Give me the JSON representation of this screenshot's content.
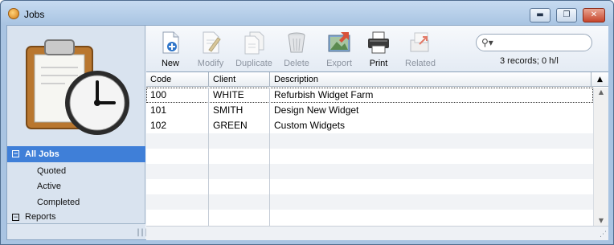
{
  "window": {
    "title": "Jobs",
    "buttons": {
      "minimize": "▬",
      "maximize": "❐",
      "close": "✕"
    }
  },
  "sidebar": {
    "items": [
      {
        "label": "All Jobs",
        "toggle": "⊟",
        "selected": true
      },
      {
        "label": "Quoted"
      },
      {
        "label": "Active"
      },
      {
        "label": "Completed"
      },
      {
        "label": "Reports",
        "toggle": "⊟"
      }
    ]
  },
  "toolbar": {
    "buttons": [
      {
        "label": "New",
        "icon": "new-document-icon",
        "enabled": true
      },
      {
        "label": "Modify",
        "icon": "modify-document-icon",
        "enabled": false
      },
      {
        "label": "Duplicate",
        "icon": "duplicate-document-icon",
        "enabled": false
      },
      {
        "label": "Delete",
        "icon": "trash-icon",
        "enabled": false
      },
      {
        "label": "Export",
        "icon": "export-icon",
        "enabled": false
      },
      {
        "label": "Print",
        "icon": "printer-icon",
        "enabled": true
      },
      {
        "label": "Related",
        "icon": "related-icon",
        "enabled": false
      }
    ],
    "search": {
      "value": "",
      "placeholder": ""
    },
    "record_count": "3 records; 0 h/l"
  },
  "table": {
    "columns": [
      "Code",
      "Client",
      "Description"
    ],
    "rows": [
      [
        "100",
        "WHITE",
        "Refurbish Widget Farm"
      ],
      [
        "101",
        "SMITH",
        "Design New Widget"
      ],
      [
        "102",
        "GREEN",
        "Custom Widgets"
      ]
    ]
  },
  "colors": {
    "selection": "#3f7fd8",
    "window_frame": "#a9c4e2",
    "alt_row": "#f1f3f6"
  }
}
